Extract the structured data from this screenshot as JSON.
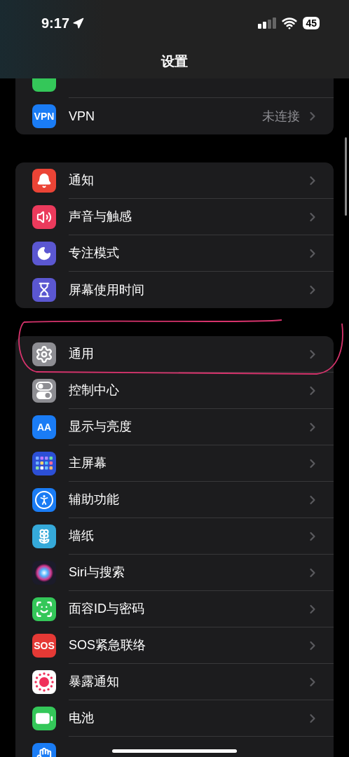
{
  "status_bar": {
    "time": "9:17",
    "battery": "45"
  },
  "title": "设置",
  "groups": [
    {
      "rows": [
        {
          "color": "#34c759",
          "cut": true
        },
        {
          "kind": "text",
          "icon_text": "VPN",
          "color": "#1a7cf5",
          "label": "VPN",
          "value": "未连接",
          "cut": false
        }
      ]
    },
    {
      "rows": [
        {
          "kind": "bell",
          "color": "#eb4436",
          "label": "通知",
          "cut": false
        },
        {
          "kind": "sound",
          "color": "#eb3a5c",
          "label": "声音与触感",
          "cut": false
        },
        {
          "kind": "moon",
          "color": "#5b57d1",
          "label": "专注模式",
          "cut": false
        },
        {
          "kind": "hourglass",
          "color": "#5b57d1",
          "label": "屏幕使用时间",
          "cut": false
        }
      ]
    },
    {
      "rows": [
        {
          "kind": "gear",
          "color": "#8e8e93",
          "label": "通用",
          "cut": false
        },
        {
          "kind": "toggles",
          "color": "#8e8e93",
          "label": "控制中心",
          "cut": false
        },
        {
          "kind": "text",
          "icon_text": "AA",
          "color": "#1a7cf5",
          "label": "显示与亮度",
          "cut": false
        },
        {
          "kind": "grid",
          "color": "#2c4fd6",
          "label": "主屏幕",
          "cut": false
        },
        {
          "kind": "accessibility",
          "color": "#1a7cf5",
          "label": "辅助功能",
          "cut": false
        },
        {
          "kind": "flower",
          "color": "#35a9d9",
          "label": "墙纸",
          "cut": false
        },
        {
          "kind": "siri",
          "color": "#1b1b2a",
          "label": "Siri与搜索",
          "cut": false
        },
        {
          "kind": "face",
          "color": "#34c759",
          "label": "面容ID与密码",
          "cut": false
        },
        {
          "kind": "text",
          "icon_text": "SOS",
          "color": "#e53935",
          "label": "SOS紧急联络",
          "cut": false
        },
        {
          "kind": "exposure",
          "color": "#ffffff",
          "label": "暴露通知",
          "cut": false
        },
        {
          "kind": "battery",
          "color": "#34c759",
          "label": "电池",
          "cut": false
        },
        {
          "kind": "hand",
          "color": "#1a7cf5",
          "cut": true
        }
      ]
    }
  ]
}
